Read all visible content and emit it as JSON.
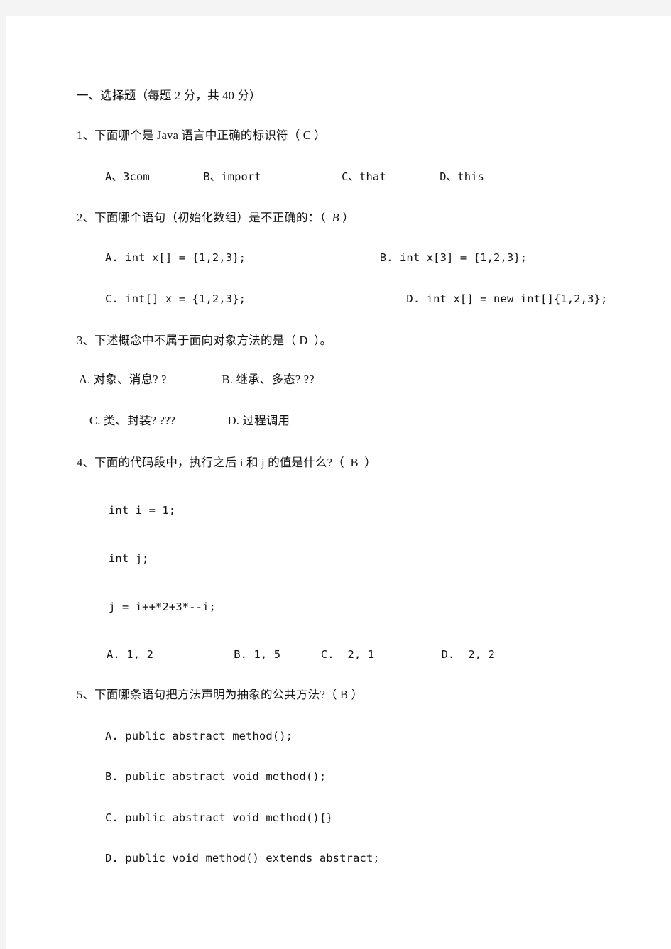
{
  "document": {
    "section_heading": "一、选择题（每题 2 分，共 40 分）",
    "questions": [
      {
        "stem": "1、下面哪个是 Java 语言中正确的标识符（ C ）",
        "options_line": "A、3com        B、import            C、that        D、this"
      },
      {
        "stem_before": "2、下面哪个语句（初始化数组）是不正确的：（  ",
        "stem_answer": "B",
        "stem_after": " ）",
        "option_lines": [
          "A. int x[] = {1,2,3};                    B. int x[3] = {1,2,3};",
          "C. int[] x = {1,2,3};                        D. int x[] = new int[]{1,2,3};"
        ]
      },
      {
        "stem": "3、下述概念中不属于面向对象方法的是（ D  ）。",
        "option_lines": [
          "A. 对象、消息? ?                  B. 继承、多态? ??",
          "C. 类、封装? ???                 D. 过程调用"
        ]
      },
      {
        "stem": "4、下面的代码段中，执行之后 i 和 j 的值是什么?（  B  ）",
        "code_lines": [
          "int i = 1;",
          "int j;",
          "j = i++*2+3*--i;"
        ],
        "options_line": "A. 1, 2            B. 1, 5      C.  2, 1          D.  2, 2"
      },
      {
        "stem": "5、下面哪条语句把方法声明为抽象的公共方法?（ B ）",
        "option_lines": [
          "A. public abstract method();",
          "B. public abstract void method();",
          "C. public abstract void method(){}",
          "D. public void method() extends abstract;"
        ]
      }
    ]
  }
}
